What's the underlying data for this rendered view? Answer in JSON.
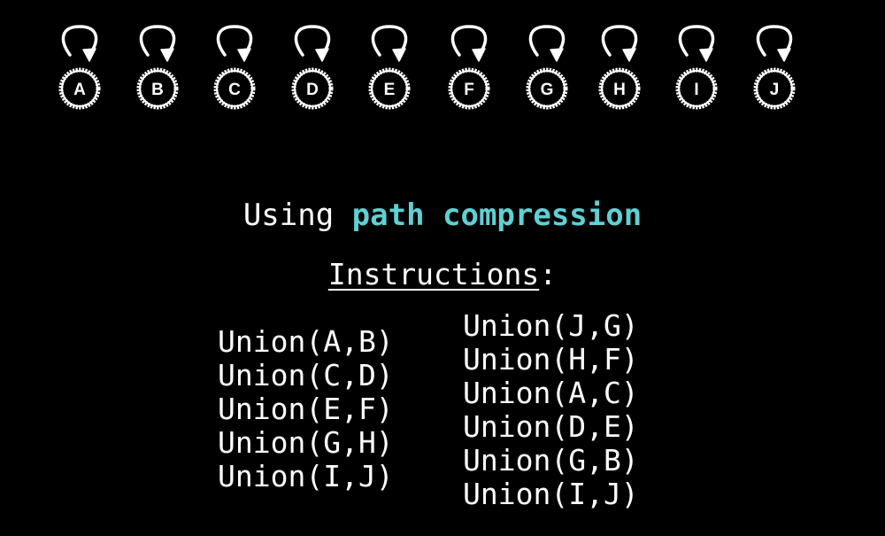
{
  "nodes": [
    "A",
    "B",
    "C",
    "D",
    "E",
    "F",
    "G",
    "H",
    "I",
    "J"
  ],
  "colors": {
    "background": "#000000",
    "text": "#ffffff",
    "highlight": "#5fd0d3"
  },
  "title": {
    "prefix": "Using ",
    "highlight": "path compression"
  },
  "instructions": {
    "label": "Instructions",
    "colon": ":"
  },
  "instructions_left": [
    "Union(A,B)",
    "Union(C,D)",
    "Union(E,F)",
    "Union(G,H)",
    "Union(I,J)"
  ],
  "instructions_right": [
    "Union(J,G)",
    "Union(H,F)",
    "Union(A,C)",
    "Union(D,E)",
    "Union(G,B)",
    "Union(I,J)"
  ]
}
